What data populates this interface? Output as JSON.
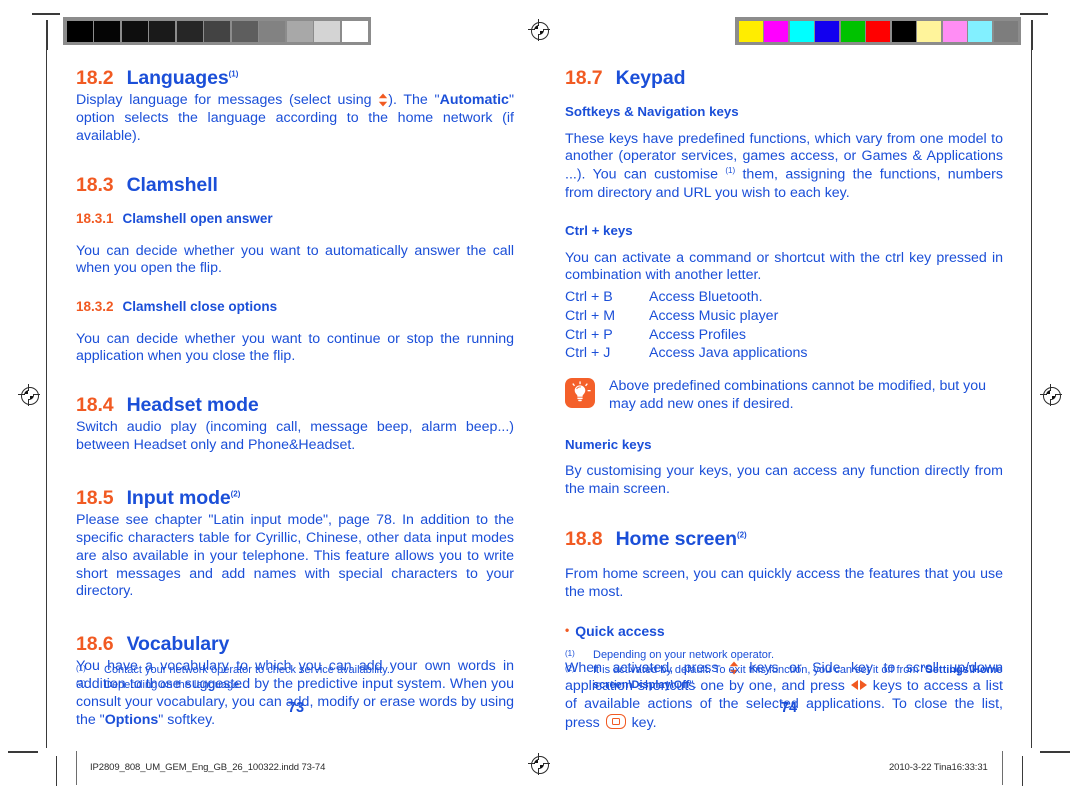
{
  "document": {
    "left_page_number": "73",
    "right_page_number": "74"
  },
  "colors": {
    "heading_number": "#f15a22",
    "heading_title": "#1b4fd8",
    "body_text": "#1b4fd8",
    "tip_badge": "#f4602a",
    "key_glyph": "#f15a22"
  },
  "calibration": {
    "grayscale_label": "grayscale-calibration-bar",
    "grayscale_patches": [
      "#000000",
      "#050505",
      "#0e0e0e",
      "#1a1a1a",
      "#262626",
      "#434343",
      "#5e5e5e",
      "#828282",
      "#a8a8a8",
      "#d4d4d4",
      "#ffffff"
    ],
    "color_label": "color-calibration-bar",
    "color_patches": [
      "#ffed00",
      "#ff00ff",
      "#00ffff",
      "#1200ef",
      "#00c200",
      "#ff0000",
      "#000000",
      "#fff49b",
      "#ff8df4",
      "#82f0ff",
      "#7d7d7d"
    ]
  },
  "left_column": {
    "section_18_2": {
      "number": "18.2",
      "title": "Languages",
      "footnote_mark": "(1)",
      "body_part_1": "Display language for messages (select using ",
      "body_part_2": "). The \"",
      "bold_term": "Automatic",
      "body_part_3": "\" option selects the language according to the home network (if available)."
    },
    "section_18_3": {
      "number": "18.3",
      "title": "Clamshell",
      "sub_18_3_1": {
        "number": "18.3.1",
        "title": "Clamshell open answer",
        "body": "You can decide whether you want to automatically answer the call when you open the flip."
      },
      "sub_18_3_2": {
        "number": "18.3.2",
        "title": "Clamshell close options",
        "body": "You can decide whether you want to continue or stop the running application when you close the flip."
      }
    },
    "section_18_4": {
      "number": "18.4",
      "title": "Headset mode",
      "body": "Switch audio play (incoming call, message beep, alarm beep...) between Headset only and Phone&Headset."
    },
    "section_18_5": {
      "number": "18.5",
      "title": "Input mode",
      "footnote_mark": "(2)",
      "body": "Please see chapter \"Latin input mode\", page 78. In addition to the specific characters table for Cyrillic, Chinese, other data input modes are also available in your telephone. This feature allows you to write short messages and add names with special characters to your directory."
    },
    "section_18_6": {
      "number": "18.6",
      "title": "Vocabulary",
      "body_part_1": "You have a vocabulary to which you can add your own words in addition to those suggested by the predictive input system. When you consult your vocabulary, you can add, modify or erase words by using the \"",
      "bold_term": "Options",
      "body_part_2": "\" softkey."
    },
    "footnotes": [
      {
        "mark": "(1)",
        "text": "Contact your network operator to check service availability."
      },
      {
        "mark": "(2)",
        "text": "Depending on the language."
      }
    ]
  },
  "right_column": {
    "section_18_7": {
      "number": "18.7",
      "title": "Keypad",
      "softkeys": {
        "heading": "Softkeys & Navigation keys",
        "body_part_1": "These keys have predefined functions, which vary from one model to another (operator services, games access, or Games & Applications ...). You can customise ",
        "footnote_mark": "(1)",
        "body_part_2": " them, assigning the functions, numbers from directory and URL you wish to each key."
      },
      "ctrl_keys": {
        "heading": "Ctrl + keys",
        "body": "You can activate a command or shortcut with the ctrl key pressed in combination with another letter.",
        "shortcuts": [
          {
            "combo": "Ctrl + B",
            "action": "Access Bluetooth."
          },
          {
            "combo": "Ctrl + M",
            "action": "Access Music player"
          },
          {
            "combo": "Ctrl + P",
            "action": "Access Profiles"
          },
          {
            "combo": "Ctrl + J",
            "action": "Access Java applications"
          }
        ],
        "tip": "Above predefined combinations cannot be modified, but you may add new ones if desired."
      },
      "numeric_keys": {
        "heading": "Numeric keys",
        "body": "By customising your keys, you can access any function directly from the main screen."
      }
    },
    "section_18_8": {
      "number": "18.8",
      "title": "Home screen",
      "footnote_mark": "(2)",
      "body": "From home screen, you can quickly access the features that you use the most.",
      "quick_access": {
        "bullet": "•",
        "heading": "Quick access",
        "body_part_1": "When activated, press ",
        "body_part_2": " keys or Side key to scroll up/down application shortcuts one by one, and press ",
        "body_part_3": " keys to access a list of available actions of the selected applications. To close the list, press ",
        "body_part_4": " key."
      }
    },
    "footnotes": [
      {
        "mark": "(1)",
        "text": "Depending on your network operator.",
        "bold_tail": ""
      },
      {
        "mark": "(2)",
        "text_part_1": "It is activated by default. To exit this function, you can set it off from \"",
        "bold_1": "Settings\\",
        "bold_2": "Home screen\\Display\\Off",
        "text_part_2": "\"."
      }
    ]
  },
  "print_slug": {
    "filename": "IP2809_808_UM_GEM_Eng_GB_26_100322.indd   73-74",
    "timestamp": "2010-3-22   Tina16:33:31"
  }
}
